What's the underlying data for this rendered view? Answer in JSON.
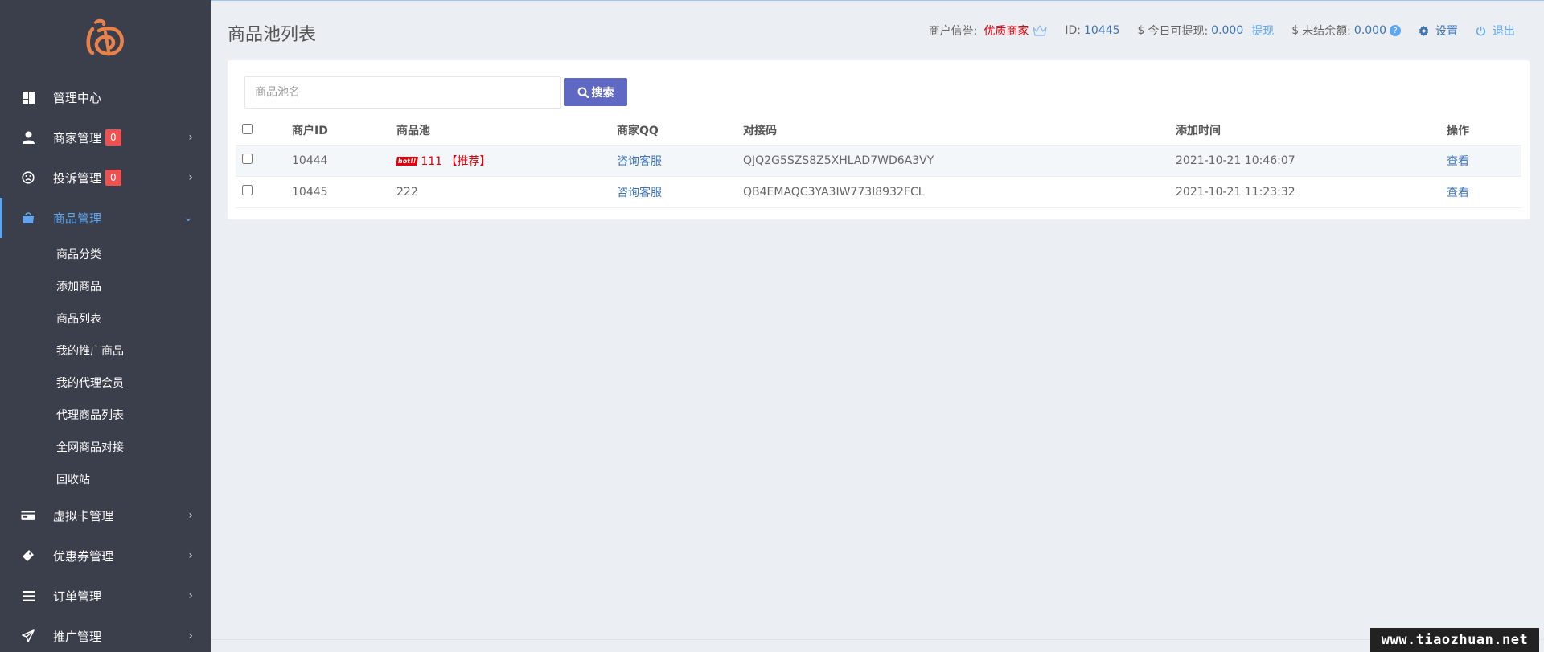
{
  "sidebar": {
    "menu": [
      {
        "label": "管理中心",
        "icon": "dashboard-icon"
      },
      {
        "label": "商家管理",
        "icon": "user-icon",
        "badge": "0"
      },
      {
        "label": "投诉管理",
        "icon": "frown-icon",
        "badge": "0"
      },
      {
        "label": "商品管理",
        "icon": "shopping-bag-icon"
      }
    ],
    "sub_items": [
      "商品分类",
      "添加商品",
      "商品列表",
      "我的推广商品",
      "我的代理会员",
      "代理商品列表",
      "全网商品对接",
      "回收站"
    ],
    "menu_bottom": [
      {
        "label": "虚拟卡管理",
        "icon": "card-icon"
      },
      {
        "label": "优惠券管理",
        "icon": "ticket-icon"
      },
      {
        "label": "订单管理",
        "icon": "list-icon"
      },
      {
        "label": "推广管理",
        "icon": "paper-plane-icon"
      }
    ]
  },
  "header": {
    "title": "商品池列表",
    "credit_label": "商户信誉:",
    "credit_value": "优质商家",
    "id_label": "ID:",
    "id_value": "10445",
    "withdraw_label": "今日可提现:",
    "withdraw_value": "0.000",
    "withdraw_link": "提现",
    "unsettled_label": "未结余额:",
    "unsettled_value": "0.000",
    "settings": "设置",
    "logout": "退出",
    "currency": "$"
  },
  "search": {
    "placeholder": "商品池名",
    "button": "搜索"
  },
  "table": {
    "headers": [
      "商户ID",
      "商品池",
      "商家QQ",
      "对接码",
      "添加时间",
      "操作"
    ],
    "rows": [
      {
        "merchant_id": "10444",
        "hot": "hot!!",
        "pool": "111 【推荐】",
        "qq": "咨询客服",
        "code": "QJQ2G5SZS8Z5XHLAD7WD6A3VY",
        "time": "2021-10-21 10:46:07",
        "action": "查看"
      },
      {
        "merchant_id": "10445",
        "pool": "222",
        "qq": "咨询客服",
        "code": "QB4EMAQC3YA3IW773I8932FCL",
        "time": "2021-10-21 11:23:32",
        "action": "查看"
      }
    ]
  },
  "watermark": "www.tiaozhuan.net",
  "colors": {
    "sidebar": "#3a3f4b",
    "accent": "#5ea7f0",
    "button": "#5f68c2",
    "red": "#e3000b",
    "badge": "#f05050"
  }
}
